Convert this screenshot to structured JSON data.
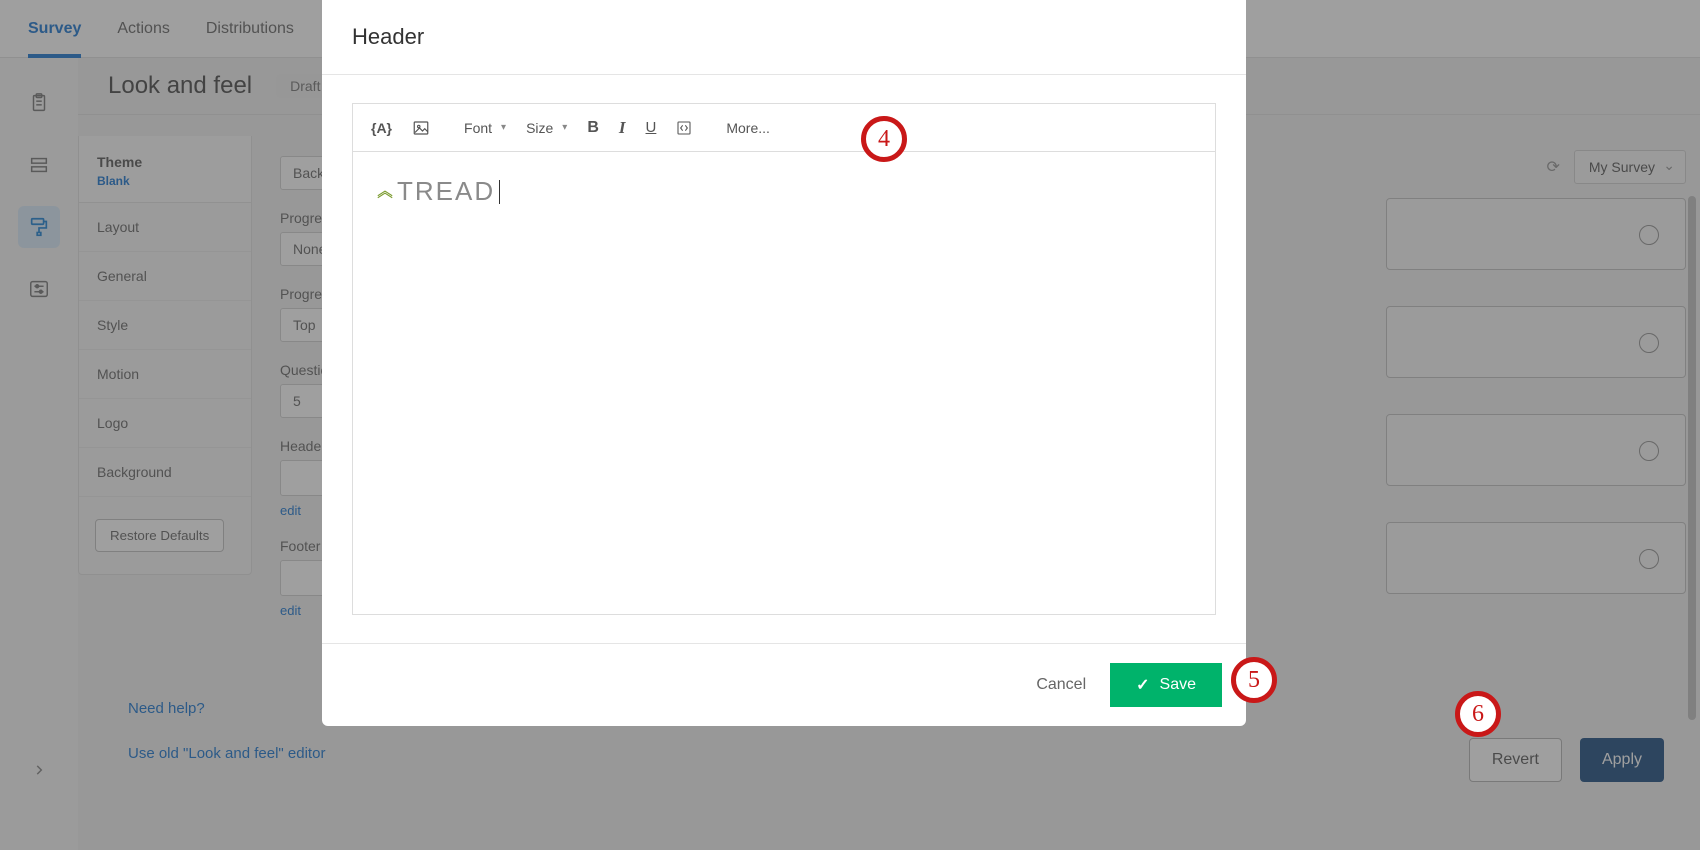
{
  "topnav": {
    "items": [
      "Survey",
      "Actions",
      "Distributions"
    ],
    "active": "Survey"
  },
  "page": {
    "title": "Look and feel",
    "status": "Draft"
  },
  "theme_sidebar": {
    "heading": "Theme",
    "theme_name": "Blank",
    "items": [
      "Layout",
      "General",
      "Style",
      "Motion",
      "Logo",
      "Background"
    ],
    "restore": "Restore Defaults"
  },
  "settings": {
    "back": "Back",
    "progress_label": "Progress",
    "progress_val": "None",
    "progress_pos_label": "Progress",
    "progress_pos_val": "Top",
    "questions_label": "Questions",
    "questions_val": "5",
    "header_label": "Header",
    "footer_label": "Footer",
    "edit": "edit"
  },
  "preview": {
    "survey_name": "My Survey"
  },
  "bottom": {
    "need_help": "Need help?",
    "old_editor": "Use old \"Look and feel\" editor",
    "revert": "Revert",
    "apply": "Apply"
  },
  "modal": {
    "title": "Header",
    "toolbar": {
      "piped": "{A}",
      "font": "Font",
      "size": "Size",
      "bold": "B",
      "italic": "I",
      "underline": "U",
      "more": "More..."
    },
    "content_logo_text": "TREAD",
    "cancel": "Cancel",
    "save": "Save"
  },
  "annotations": {
    "a4": "4",
    "a5": "5",
    "a6": "6"
  }
}
